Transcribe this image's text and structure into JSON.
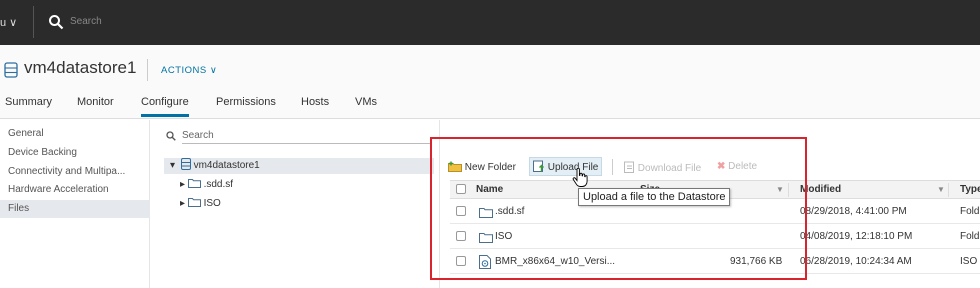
{
  "topbar": {
    "menu_label": "u ∨",
    "search_placeholder": "Search"
  },
  "header": {
    "title": "vm4datastore1",
    "actions_label": "ACTIONS ∨"
  },
  "tabs": [
    "Summary",
    "Monitor",
    "Configure",
    "Permissions",
    "Hosts",
    "VMs"
  ],
  "active_tab": "Configure",
  "sidebar": {
    "items": [
      "General",
      "Device Backing",
      "Connectivity and Multipa...",
      "Hardware Acceleration",
      "Files"
    ],
    "active": "Files"
  },
  "tree": {
    "search_placeholder": "Search",
    "root": "vm4datastore1",
    "children": [
      ".sdd.sf",
      "ISO"
    ]
  },
  "toolbar": {
    "new_folder": "New Folder",
    "upload_file": "Upload File",
    "download_file": "Download File",
    "delete": "Delete"
  },
  "grid": {
    "columns": [
      "Name",
      "Size",
      "Modified",
      "Type"
    ],
    "rows": [
      {
        "name": ".sdd.sf",
        "size": "",
        "modified": "08/29/2018, 4:41:00 PM",
        "type": "Fold"
      },
      {
        "name": "ISO",
        "size": "",
        "modified": "04/08/2019, 12:18:10 PM",
        "type": "Fold"
      },
      {
        "name": "BMR_x86x64_w10_Versi...",
        "size": "931,766 KB",
        "modified": "06/28/2019, 10:24:34 AM",
        "type": "ISO"
      }
    ]
  },
  "tooltip": "Upload a file to the Datastore",
  "colors": {
    "accent": "#0072a3",
    "highlight": "#d9232d",
    "topbar": "#2b2b2b"
  }
}
